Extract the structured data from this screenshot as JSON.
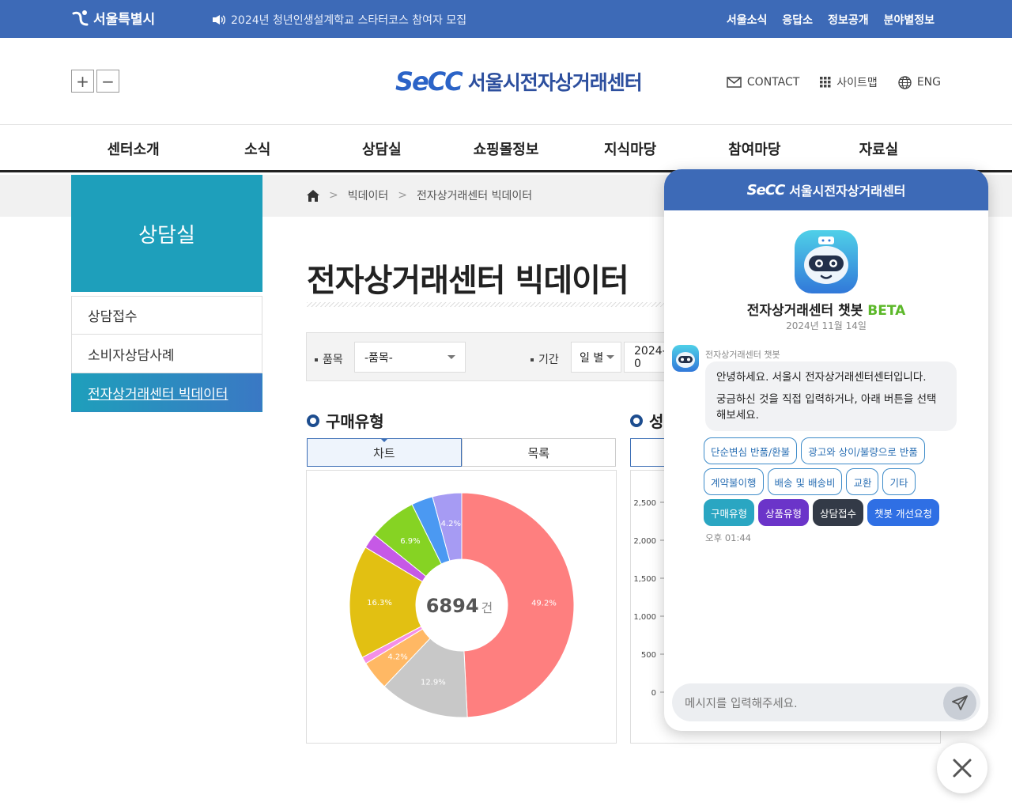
{
  "topbar": {
    "logo": "서울특별시",
    "notice": "2024년 청년인생설계학교 스타터코스 참여자 모집",
    "links": [
      "서울소식",
      "응답소",
      "정보공개",
      "분야별정보"
    ]
  },
  "header": {
    "zoom_in": "+",
    "zoom_out": "−",
    "brand_abbr": "SeCC",
    "brand_name": "서울시전자상거래센터",
    "util": {
      "contact": "CONTACT",
      "sitemap": "사이트맵",
      "eng": "ENG"
    }
  },
  "gnb": [
    "센터소개",
    "소식",
    "상담실",
    "쇼핑몰정보",
    "지식마당",
    "참여마당",
    "자료실"
  ],
  "breadcrumb": [
    "빅데이터",
    "전자상거래센터 빅데이터"
  ],
  "sidebar": {
    "title": "상담실",
    "items": [
      {
        "label": "상담접수",
        "active": false
      },
      {
        "label": "소비자상담사례",
        "active": false
      },
      {
        "label": "전자상거래센터 빅데이터",
        "active": true
      }
    ]
  },
  "main": {
    "title": "전자상거래센터 빅데이터",
    "filter": {
      "item_label": "품목",
      "item_value": "-품목-",
      "period_label": "기간",
      "unit_value": "일 별",
      "date_value": "2024-0"
    },
    "section1": {
      "title": "구매유형",
      "tab_chart": "차트",
      "tab_list": "목록"
    },
    "section2": {
      "title": "성"
    }
  },
  "chart_data": [
    {
      "type": "pie",
      "title": "구매유형",
      "center_value": "6894",
      "center_unit": "건",
      "slices": [
        {
          "value": 49.2,
          "label": "49.2%",
          "color": "#fe7f7f"
        },
        {
          "value": 12.9,
          "label": "12.9%",
          "color": "#c8c8c8"
        },
        {
          "value": 4.2,
          "label": "4.2%",
          "color": "#ffb864"
        },
        {
          "value": 1.0,
          "label": "",
          "color": "#f48fe6"
        },
        {
          "value": 16.3,
          "label": "16.3%",
          "color": "#e2c012"
        },
        {
          "value": 2.2,
          "label": "",
          "color": "#c659e6"
        },
        {
          "value": 6.9,
          "label": "6.9%",
          "color": "#86d323"
        },
        {
          "value": 3.1,
          "label": "",
          "color": "#4b99f2"
        },
        {
          "value": 4.2,
          "label": "4.2%",
          "color": "#a69bf3"
        }
      ]
    },
    {
      "type": "bar",
      "ylim": [
        0,
        2500
      ],
      "yticks": [
        "2,500",
        "2,000",
        "1,500",
        "1,000",
        "500",
        "0"
      ]
    }
  ],
  "chatbot": {
    "header_abbr": "SeCC",
    "header_name": "서울시전자상거래센터",
    "bot_name": "전자상거래센터 챗봇",
    "beta": "BETA",
    "date": "2024년 11월 14일",
    "sender": "전자상거래센터 챗봇",
    "message_1": "안녕하세요. 서울시 전자상거래센터센터입니다.",
    "message_2": "궁금하신 것을 직접 입력하거나, 아래 버튼을 선택해보세요.",
    "chips": [
      "단순변심 반품/환불",
      "광고와 상이/불량으로 반품",
      "계약불이행",
      "배송 및 배송비",
      "교환",
      "기타"
    ],
    "chips_colored": [
      "구매유형",
      "상품유형",
      "상담접수",
      "챗봇 개선요청"
    ],
    "time": "오후 01:44",
    "input_placeholder": "메시지를 입력해주세요."
  }
}
